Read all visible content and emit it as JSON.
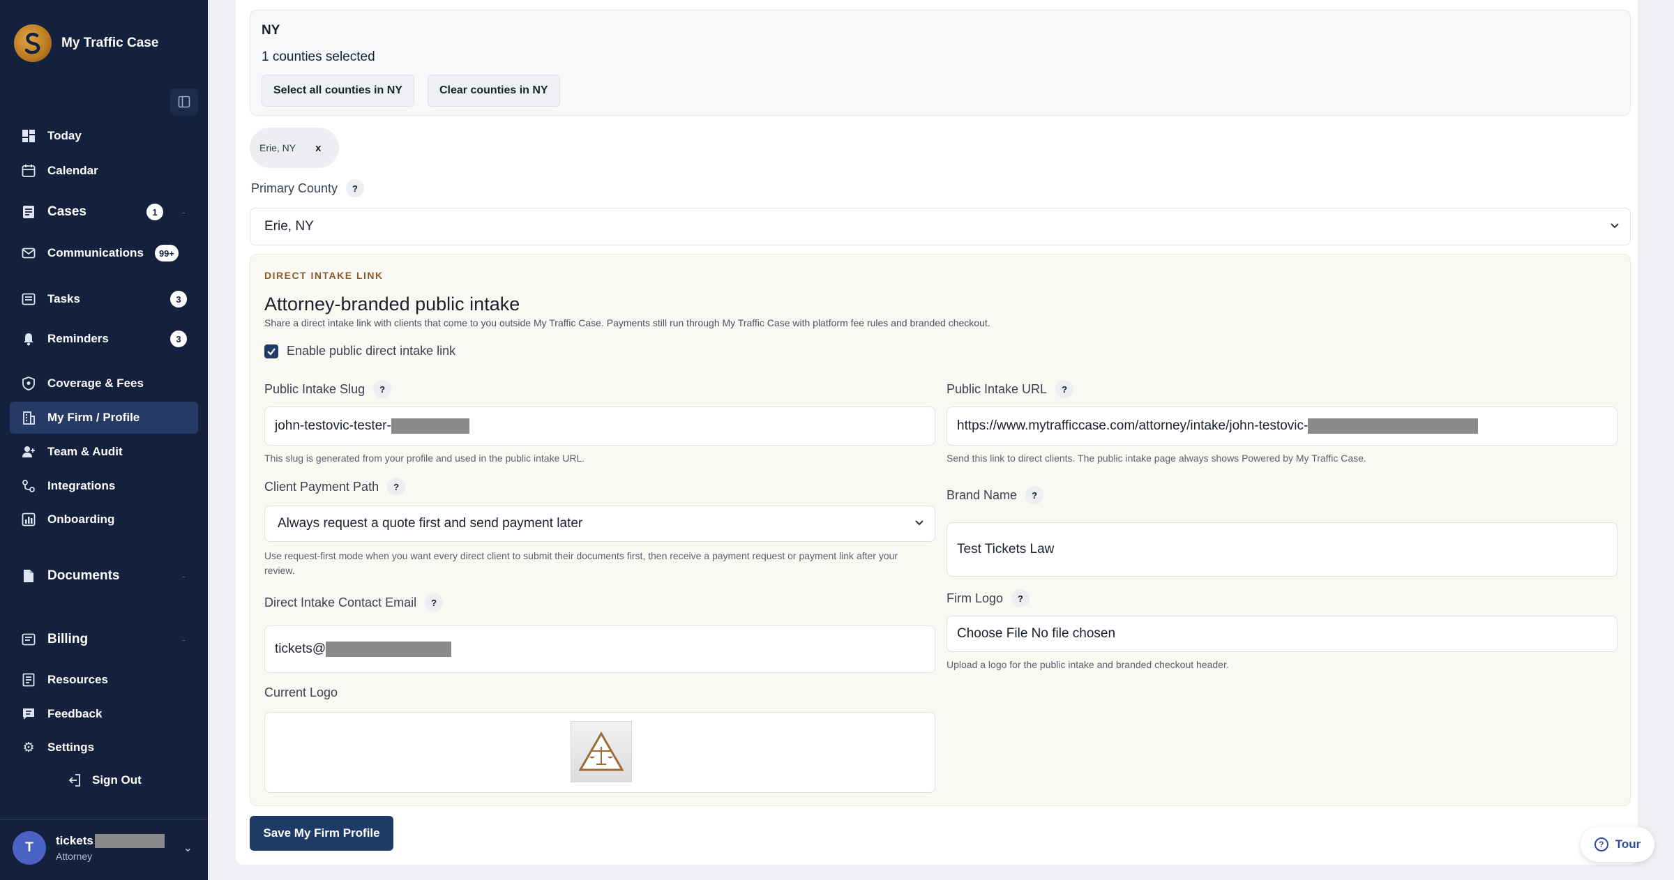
{
  "app": {
    "name": "My Traffic Case",
    "colors": {
      "sidebar": "#14213d",
      "primary": "#1e3a66",
      "accent": "#8a5a2c"
    }
  },
  "sidebar": {
    "collapse_icon": "sidebar-collapse-icon",
    "items": [
      {
        "label": "Today",
        "icon": "dashboard-icon"
      },
      {
        "label": "Calendar",
        "icon": "calendar-icon"
      },
      {
        "label": "Cases",
        "icon": "cases-icon",
        "badge": "1"
      },
      {
        "label": "Communications",
        "icon": "mail-icon",
        "badge": "99+"
      },
      {
        "label": "Tasks",
        "icon": "tasks-icon",
        "badge": "3"
      },
      {
        "label": "Reminders",
        "icon": "bell-icon",
        "badge": "3"
      },
      {
        "label": "Coverage & Fees",
        "icon": "shield-icon"
      },
      {
        "label": "My Firm / Profile",
        "icon": "building-icon",
        "active": true
      },
      {
        "label": "Team & Audit",
        "icon": "user-plus-icon"
      },
      {
        "label": "Integrations",
        "icon": "link-icon"
      },
      {
        "label": "Onboarding",
        "icon": "onboarding-icon"
      },
      {
        "label": "Documents",
        "icon": "document-icon"
      },
      {
        "label": "Billing",
        "icon": "billing-icon"
      },
      {
        "label": "Resources",
        "icon": "resources-icon"
      },
      {
        "label": "Feedback",
        "icon": "feedback-icon"
      },
      {
        "label": "Settings",
        "icon": "gear-icon"
      }
    ],
    "sign_out": "Sign Out",
    "user": {
      "initial": "T",
      "name": "tickets",
      "role": "Attorney"
    }
  },
  "coverage": {
    "state": "NY",
    "count_text": "1 counties selected",
    "select_all": "Select all counties in NY",
    "clear": "Clear counties in NY",
    "selected_tags": [
      "Erie, NY"
    ],
    "remove_symbol": "x"
  },
  "primary_county": {
    "label": "Primary County",
    "value": "Erie, NY"
  },
  "direct_intake": {
    "kicker": "DIRECT INTAKE LINK",
    "title": "Attorney-branded public intake",
    "description": "Share a direct intake link with clients that come to you outside My Traffic Case. Payments still run through My Traffic Case with platform fee rules and branded checkout.",
    "enable_label": "Enable public direct intake link",
    "enabled": true,
    "slug": {
      "label": "Public Intake Slug",
      "value": "john-testovic-tester-",
      "hint": "This slug is generated from your profile and used in the public intake URL."
    },
    "url": {
      "label": "Public Intake URL",
      "value": "https://www.mytrafficcase.com/attorney/intake/john-testovic-",
      "hint": "Send this link to direct clients. The public intake page always shows Powered by My Traffic Case."
    },
    "payment_path": {
      "label": "Client Payment Path",
      "value": "Always request a quote first and send payment later",
      "hint": "Use request-first mode when you want every direct client to submit their documents first, then receive a payment request or payment link after your review."
    },
    "brand_name": {
      "label": "Brand Name",
      "value": "Test Tickets Law"
    },
    "contact_email": {
      "label": "Direct Intake Contact Email",
      "value": "tickets@"
    },
    "firm_logo": {
      "label": "Firm Logo",
      "value": "Choose File No file chosen",
      "hint": "Upload a logo for the public intake and branded checkout header."
    },
    "current_logo": {
      "label": "Current Logo"
    }
  },
  "actions": {
    "save": "Save My Firm Profile",
    "tour": "Tour",
    "help_symbol": "?"
  }
}
